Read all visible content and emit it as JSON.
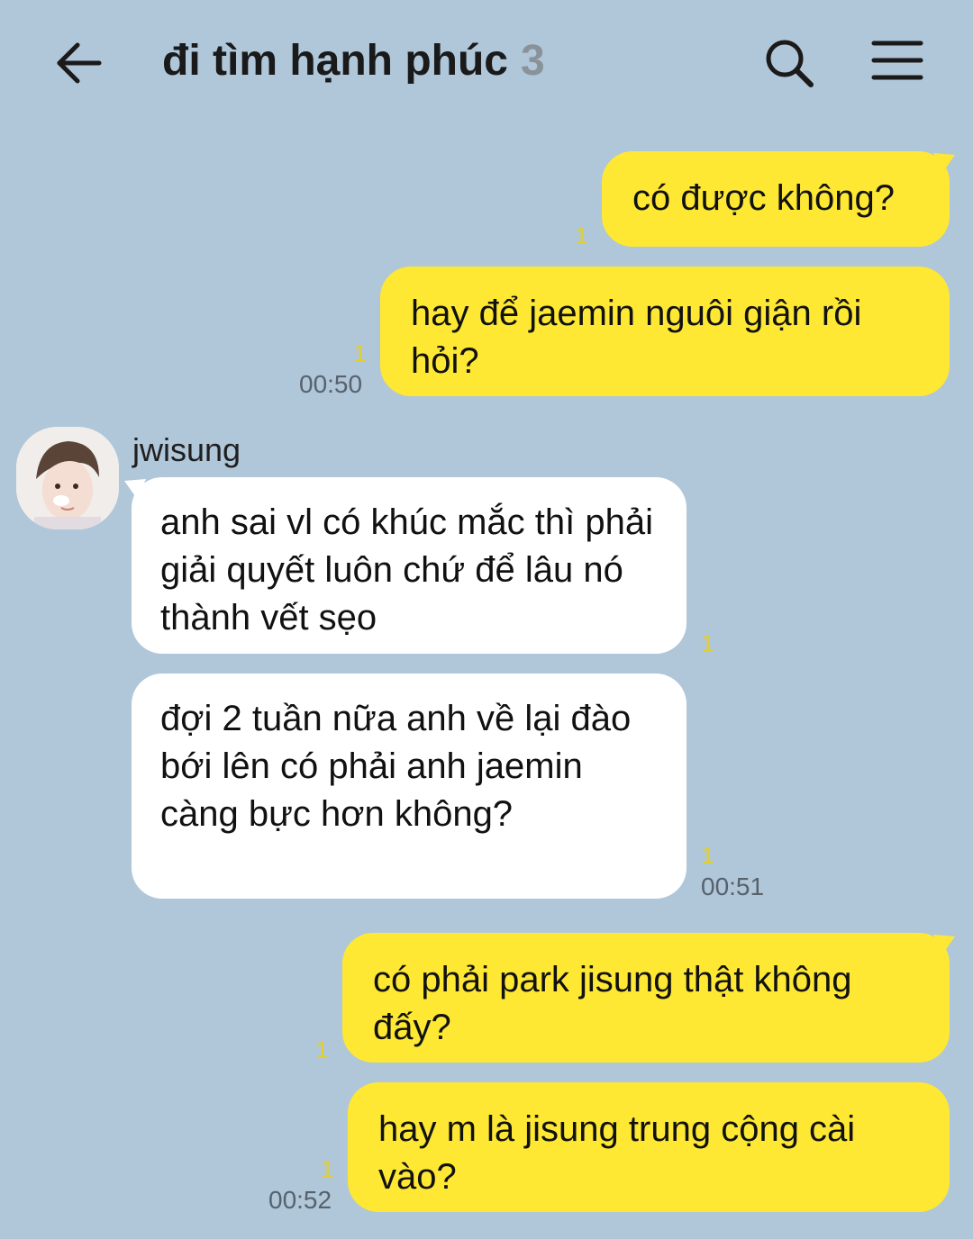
{
  "header": {
    "title": "đi tìm hạnh phúc",
    "member_count": "3",
    "back_icon": "arrow-left-icon",
    "search_icon": "search-icon",
    "menu_icon": "hamburger-menu-icon"
  },
  "messages": [
    {
      "text": "có được không?",
      "unread": "1",
      "time": ""
    },
    {
      "text": "hay để jaemin nguôi giận rồi hỏi?",
      "unread": "1",
      "time": "00:50"
    },
    {
      "text": "anh sai vl có khúc mắc thì phải giải quyết luôn chứ để lâu nó thành vết sẹo",
      "unread": "1",
      "time": ""
    },
    {
      "text": "đợi 2 tuần nữa anh về lại đào bới lên có phải anh jaemin càng bực hơn không?",
      "unread": "1",
      "time": "00:51"
    },
    {
      "text": "có phải park jisung thật không đấy?",
      "unread": "1",
      "time": ""
    },
    {
      "text": "hay m là jisung trung cộng cài vào?",
      "unread": "1",
      "time": "00:52"
    }
  ],
  "sender": {
    "name": "jwisung"
  },
  "colors": {
    "background": "#b0c6d9",
    "my_bubble": "#fee833",
    "other_bubble": "#ffffff",
    "unread": "#e2cf2a"
  }
}
